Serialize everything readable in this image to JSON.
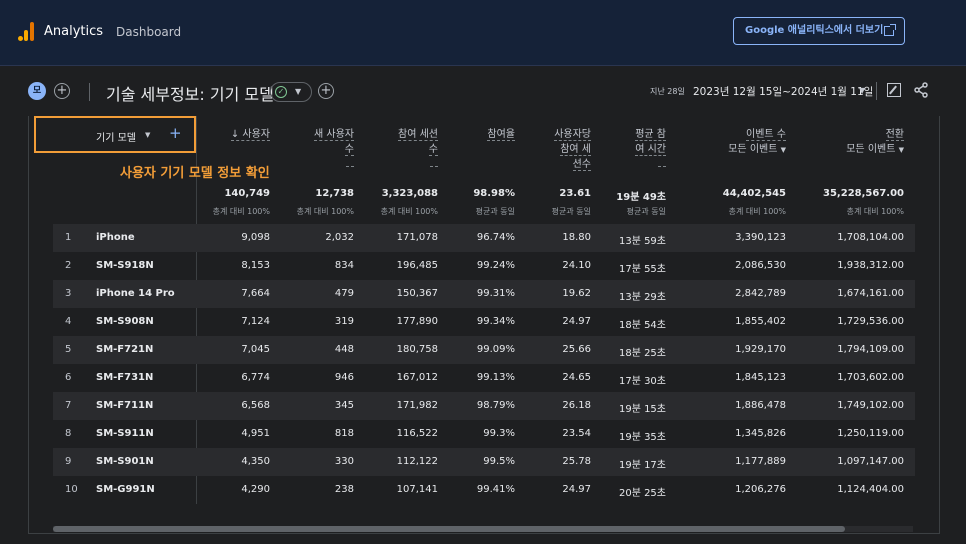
{
  "topbar": {
    "app_name": "Analytics",
    "breadcrumb": "Dashboard",
    "ga_button": "Google 애널리틱스에서 더보기",
    "brand_colors": {
      "bar_light": "#f9ab00",
      "bar_dark": "#e37400"
    }
  },
  "header": {
    "avatar": "모",
    "title": "기술 세부정보: 기기 모델",
    "date_prefix": "지난 28일",
    "date_range": "2023년 12월 15일~2024년 1월 11일"
  },
  "table": {
    "dimension_label": "기기 모델",
    "annotation": "사용자 기기 모델 정보 확인",
    "columns": [
      {
        "l1": "↓ 사용자",
        "l2": "",
        "l3": ""
      },
      {
        "l1": "새 사용자",
        "l2": "수",
        "l3": ""
      },
      {
        "l1": "참여 세션",
        "l2": "수",
        "l3": ""
      },
      {
        "l1": "참여율",
        "l2": "",
        "l3": ""
      },
      {
        "l1": "사용자당",
        "l2": "참여 세",
        "l3": "션수"
      },
      {
        "l1": "평균 참",
        "l2": "여 시간",
        "l3": ""
      },
      {
        "l1": "이벤트 수",
        "l2": "모든 이벤트",
        "l3": ""
      },
      {
        "l1": "전환",
        "l2": "모든 이벤트",
        "l3": ""
      }
    ],
    "totals": [
      "140,749",
      "12,738",
      "3,323,088",
      "98.98%",
      "23.61",
      "19분 49초",
      "44,402,545",
      "35,228,567.00"
    ],
    "totals_sub": [
      "총계 대비 100%",
      "총계 대비 100%",
      "총계 대비 100%",
      "평균과 동일",
      "평균과 동일",
      "평균과 동일",
      "총계 대비 100%",
      "총계 대비 100%"
    ],
    "rows": [
      {
        "idx": "1",
        "name": "iPhone",
        "v": [
          "9,098",
          "2,032",
          "171,078",
          "96.74%",
          "18.80",
          "13분 59초",
          "3,390,123",
          "1,708,104.00"
        ]
      },
      {
        "idx": "2",
        "name": "SM-S918N",
        "v": [
          "8,153",
          "834",
          "196,485",
          "99.24%",
          "24.10",
          "17분 55초",
          "2,086,530",
          "1,938,312.00"
        ]
      },
      {
        "idx": "3",
        "name": "iPhone 14 Pro",
        "v": [
          "7,664",
          "479",
          "150,367",
          "99.31%",
          "19.62",
          "13분 29초",
          "2,842,789",
          "1,674,161.00"
        ]
      },
      {
        "idx": "4",
        "name": "SM-S908N",
        "v": [
          "7,124",
          "319",
          "177,890",
          "99.34%",
          "24.97",
          "18분 54초",
          "1,855,402",
          "1,729,536.00"
        ]
      },
      {
        "idx": "5",
        "name": "SM-F721N",
        "v": [
          "7,045",
          "448",
          "180,758",
          "99.09%",
          "25.66",
          "18분 25초",
          "1,929,170",
          "1,794,109.00"
        ]
      },
      {
        "idx": "6",
        "name": "SM-F731N",
        "v": [
          "6,774",
          "946",
          "167,012",
          "99.13%",
          "24.65",
          "17분 30초",
          "1,845,123",
          "1,703,602.00"
        ]
      },
      {
        "idx": "7",
        "name": "SM-F711N",
        "v": [
          "6,568",
          "345",
          "171,982",
          "98.79%",
          "26.18",
          "19분 15초",
          "1,886,478",
          "1,749,102.00"
        ]
      },
      {
        "idx": "8",
        "name": "SM-S911N",
        "v": [
          "4,951",
          "818",
          "116,522",
          "99.3%",
          "23.54",
          "19분 35초",
          "1,345,826",
          "1,250,119.00"
        ]
      },
      {
        "idx": "9",
        "name": "SM-S901N",
        "v": [
          "4,350",
          "330",
          "112,122",
          "99.5%",
          "25.78",
          "19분 17초",
          "1,177,889",
          "1,097,147.00"
        ]
      },
      {
        "idx": "10",
        "name": "SM-G991N",
        "v": [
          "4,290",
          "238",
          "107,141",
          "99.41%",
          "24.97",
          "20분 25초",
          "1,206,276",
          "1,124,404.00"
        ]
      }
    ]
  },
  "highlight_color": "#f29d38"
}
